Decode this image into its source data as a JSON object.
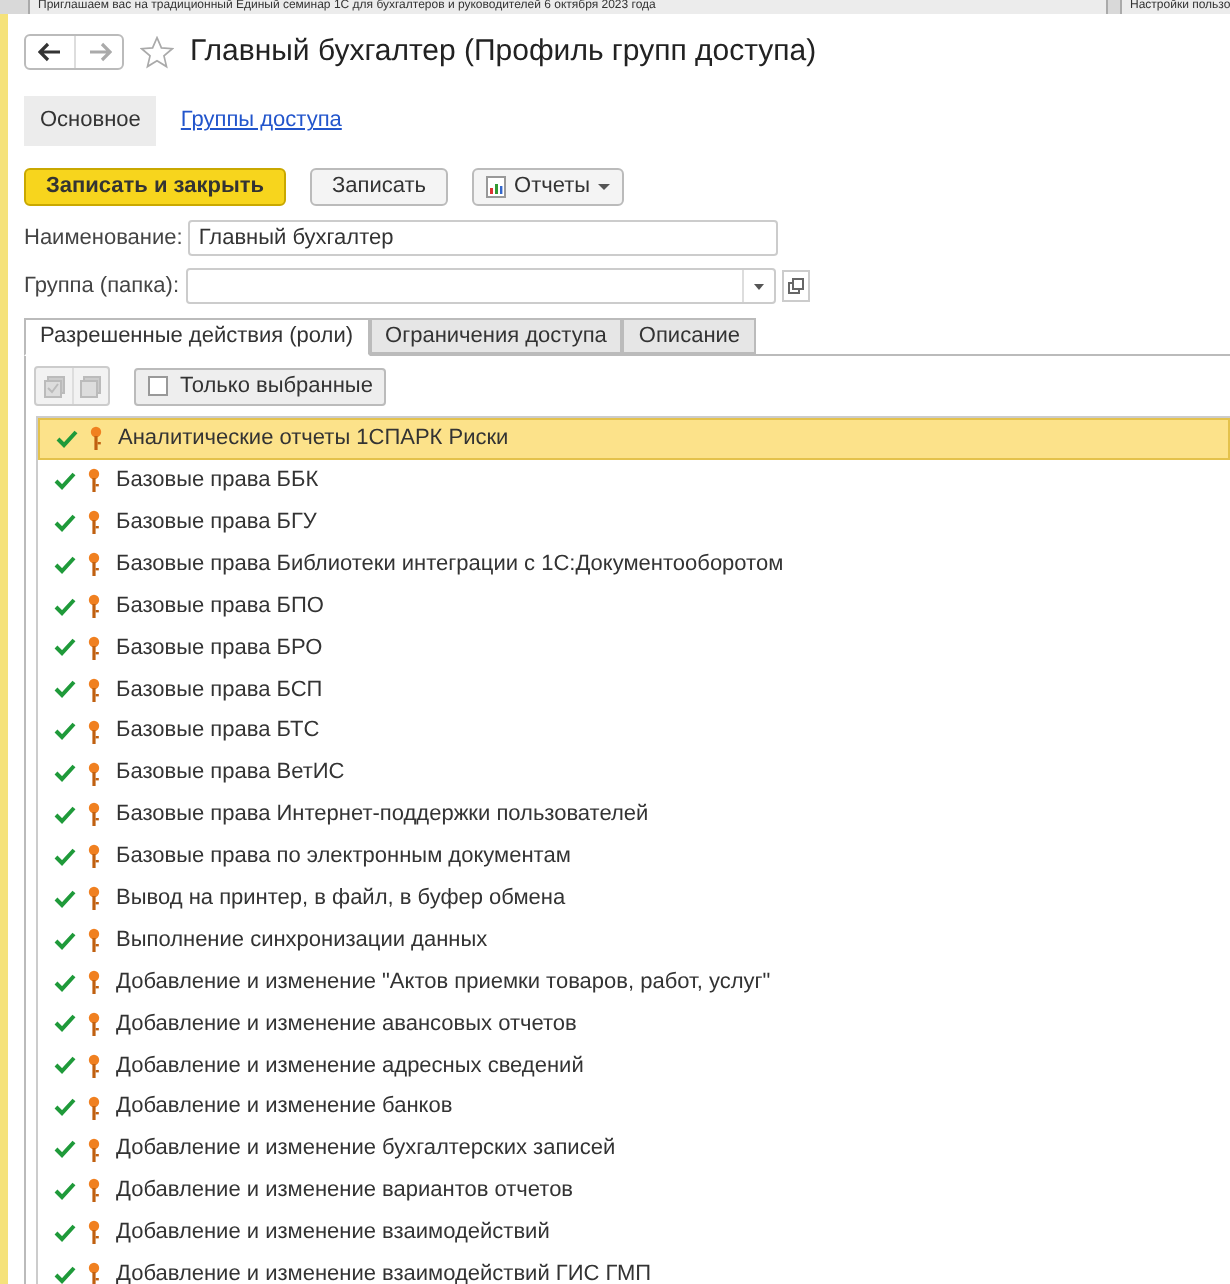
{
  "browser_tabs": [
    {
      "title": "Приглашаем вас на традиционный Единый семинар 1С для бухгалтеров и руководителей 6 октября 2023 года",
      "selected": false
    },
    {
      "title": "Настройки пользо",
      "selected": false
    }
  ],
  "window": {
    "title": "Главный бухгалтер (Профиль групп доступа)",
    "favorite": false
  },
  "sections": [
    {
      "label": "Основное",
      "selected": true
    },
    {
      "label": "Группы доступа",
      "selected": false
    }
  ],
  "toolbar": {
    "primary": "Записать и закрыть",
    "save": "Записать",
    "reports": "Отчеты"
  },
  "fields": [
    {
      "label": "Наименование:",
      "value": "Главный бухгалтер",
      "kind": "text"
    },
    {
      "label": "Группа (папка):",
      "kind": "select"
    }
  ],
  "tabs": [
    {
      "label": "Разрешенные действия (роли)",
      "selected": true
    },
    {
      "label": "Ограничения доступа",
      "selected": false
    },
    {
      "label": "Описание",
      "selected": false
    }
  ],
  "filter": {
    "label": "Только выбранные",
    "checked": false
  },
  "roles": [
    {
      "name": "Аналитические отчеты 1СПАРК Риски",
      "checked": true,
      "selected": true
    },
    {
      "name": "Базовые права ББК",
      "checked": true,
      "selected": false
    },
    {
      "name": "Базовые права БГУ",
      "checked": true,
      "selected": false
    },
    {
      "name": "Базовые права Библиотеки интеграции с 1С:Документооборотом",
      "checked": true,
      "selected": false
    },
    {
      "name": "Базовые права БПО",
      "checked": true,
      "selected": false
    },
    {
      "name": "Базовые права БРО",
      "checked": true,
      "selected": false
    },
    {
      "name": "Базовые права БСП",
      "checked": true,
      "selected": false
    },
    {
      "name": "Базовые права БТС",
      "checked": true,
      "selected": false
    },
    {
      "name": "Базовые права ВетИС",
      "checked": true,
      "selected": false
    },
    {
      "name": "Базовые права Интернет-поддержки пользователей",
      "checked": true,
      "selected": false
    },
    {
      "name": "Базовые права по электронным документам",
      "checked": true,
      "selected": false
    },
    {
      "name": "Вывод на принтер, в файл, в буфер обмена",
      "checked": true,
      "selected": false
    },
    {
      "name": "Выполнение синхронизации данных",
      "checked": true,
      "selected": false
    },
    {
      "name": "Добавление и изменение \"Актов приемки товаров, работ, услуг\"",
      "checked": true,
      "selected": false
    },
    {
      "name": "Добавление и изменение авансовых отчетов",
      "checked": true,
      "selected": false
    },
    {
      "name": "Добавление и изменение адресных сведений",
      "checked": true,
      "selected": false
    },
    {
      "name": "Добавление и изменение банков",
      "checked": true,
      "selected": false
    },
    {
      "name": "Добавление и изменение бухгалтерских записей",
      "checked": true,
      "selected": false
    },
    {
      "name": "Добавление и изменение вариантов отчетов",
      "checked": true,
      "selected": false
    },
    {
      "name": "Добавление и изменение взаимодействий",
      "checked": true,
      "selected": false
    },
    {
      "name": "Добавление и изменение взаимодействий ГИС ГМП",
      "checked": true,
      "selected": false
    }
  ]
}
